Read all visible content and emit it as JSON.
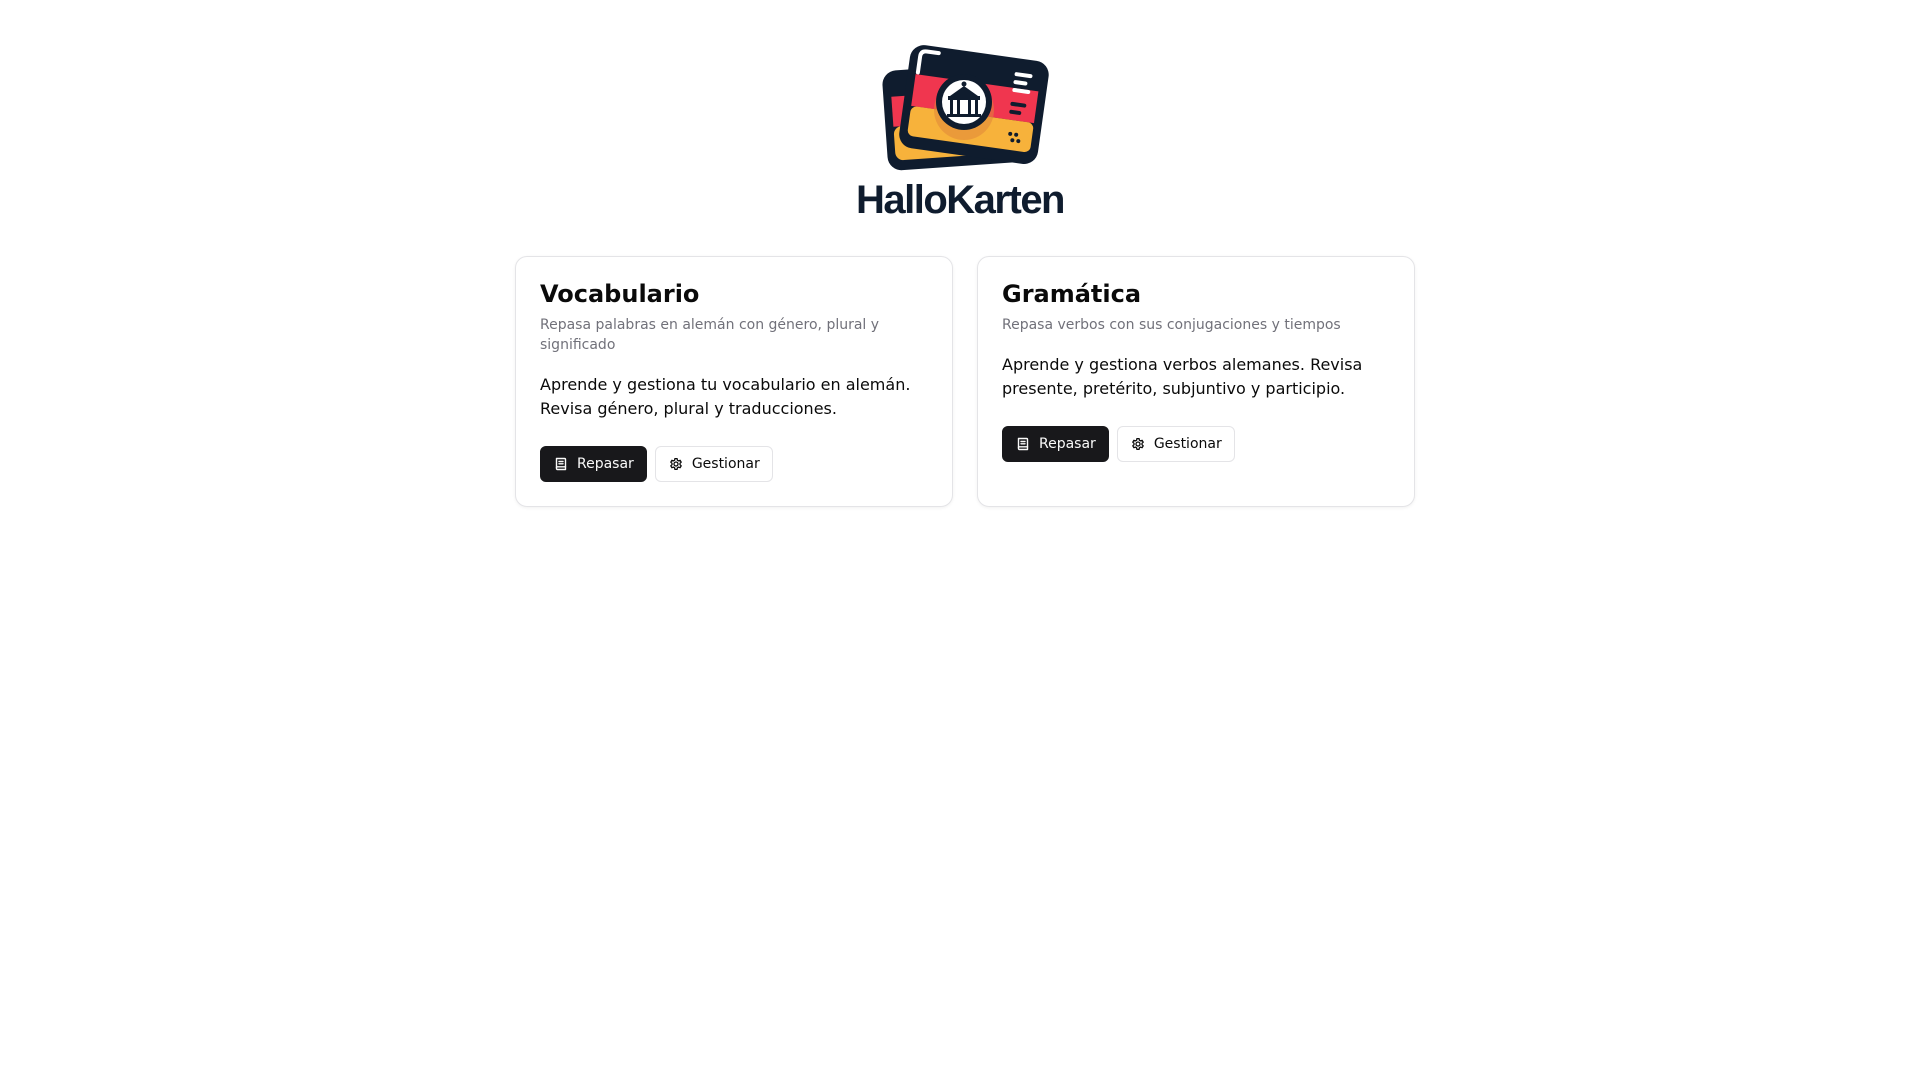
{
  "brand": {
    "name": "HalloKarten",
    "logo_icon": "flashcards-logo-icon",
    "colors": {
      "dark": "#0f1c2e",
      "red": "#f0364f",
      "gold": "#f7b23b"
    }
  },
  "cards": [
    {
      "title": "Vocabulario",
      "description": "Repasa palabras en alemán con género, plural y significado",
      "body": "Aprende y gestiona tu vocabulario en alemán. Revisa género, plural y traducciones.",
      "primary_action": {
        "label": "Repasar",
        "icon": "book-icon"
      },
      "secondary_action": {
        "label": "Gestionar",
        "icon": "gear-icon"
      }
    },
    {
      "title": "Gramática",
      "description": "Repasa verbos con sus conjugaciones y tiempos",
      "body": "Aprende y gestiona verbos alemanes. Revisa presente, pretérito, subjuntivo y participio.",
      "primary_action": {
        "label": "Repasar",
        "icon": "book-icon"
      },
      "secondary_action": {
        "label": "Gestionar",
        "icon": "gear-icon"
      }
    }
  ],
  "theme": {
    "primary_button_bg": "#18181b",
    "border": "#e4e4e7",
    "muted_text": "#71717a"
  }
}
